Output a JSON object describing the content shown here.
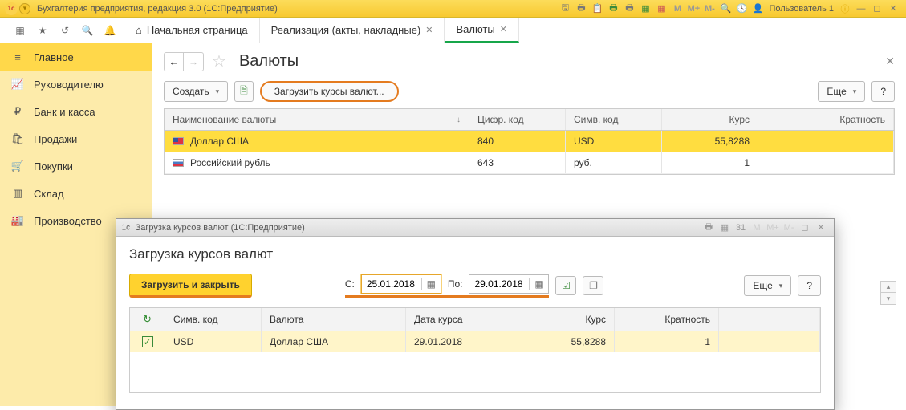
{
  "titlebar": {
    "app_title": "Бухгалтерия предприятия, редакция 3.0  (1С:Предприятие)",
    "zoom_m": "M",
    "zoom_mp": "M+",
    "zoom_mm": "M-",
    "user": "Пользователь 1"
  },
  "tabs": {
    "home": "Начальная страница",
    "t1": "Реализация (акты, накладные)",
    "t2": "Валюты"
  },
  "sidebar": {
    "items": [
      {
        "label": "Главное"
      },
      {
        "label": "Руководителю"
      },
      {
        "label": "Банк и касса"
      },
      {
        "label": "Продажи"
      },
      {
        "label": "Покупки"
      },
      {
        "label": "Склад"
      },
      {
        "label": "Производство"
      }
    ]
  },
  "page": {
    "title": "Валюты",
    "create_btn": "Создать",
    "load_btn": "Загрузить курсы валют...",
    "more_btn": "Еще",
    "help_btn": "?",
    "cols": {
      "name": "Наименование валюты",
      "num": "Цифр. код",
      "sym": "Симв. код",
      "rate": "Курс",
      "mult": "Кратность"
    },
    "rows": [
      {
        "name": "Доллар США",
        "num": "840",
        "sym": "USD",
        "rate": "55,8288",
        "mult": "",
        "sel": true,
        "flag": "us"
      },
      {
        "name": "Российский рубль",
        "num": "643",
        "sym": "руб.",
        "rate": "1",
        "mult": "",
        "sel": false,
        "flag": "ru"
      }
    ]
  },
  "dialog": {
    "win_title": "Загрузка курсов валют  (1С:Предприятие)",
    "title": "Загрузка курсов валют",
    "load_close": "Загрузить и закрыть",
    "from_lbl": "С:",
    "to_lbl": "По:",
    "from_date": "25.01.2018",
    "to_date": "29.01.2018",
    "more_btn": "Еще",
    "help_btn": "?",
    "cols": {
      "sym": "Симв. код",
      "val": "Валюта",
      "date": "Дата курса",
      "rate": "Курс",
      "mult": "Кратность"
    },
    "row": {
      "sym": "USD",
      "val": "Доллар США",
      "date": "29.01.2018",
      "rate": "55,8288",
      "mult": "1"
    },
    "tb": {
      "m": "M",
      "mp": "M+",
      "mm": "M-"
    }
  }
}
